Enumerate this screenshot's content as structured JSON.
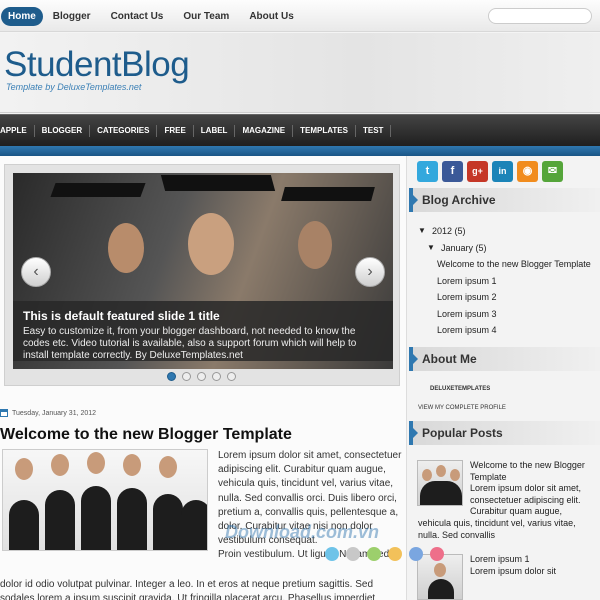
{
  "topnav": {
    "items": [
      {
        "label": "Home",
        "active": true
      },
      {
        "label": "Blogger"
      },
      {
        "label": "Contact Us"
      },
      {
        "label": "Our Team"
      },
      {
        "label": "About Us"
      }
    ],
    "search_placeholder": ""
  },
  "header": {
    "title": "StudentBlog",
    "tagline": "Template by DeluxeTemplates.net"
  },
  "categories": [
    "APPLE",
    "BLOGGER",
    "CATEGORIES",
    "FREE",
    "LABEL",
    "MAGAZINE",
    "TEMPLATES",
    "TEST"
  ],
  "slider": {
    "title": "This is default featured slide 1 title",
    "text": "Easy to customize it, from your blogger dashboard, not needed to know the codes etc. Video tutorial is available, also a support forum which will help to install template correctly. By DeluxeTemplates.net",
    "prev": "‹",
    "next": "›",
    "slide_count": 5,
    "active_slide": 1
  },
  "post": {
    "date": "Tuesday, January 31, 2012",
    "title": "Welcome to the new Blogger Template",
    "text_right": "Lorem ipsum dolor sit amet, consectetuer adipiscing elit. Curabitur quam augue, vehicula quis, tincidunt vel, varius vitae, nulla. Sed convallis orci. Duis libero orci, pretium a, convallis quis, pellentesque a, dolor. Curabitur vitae nisi non dolor vestibulum consequat.",
    "text_right2": "Proin vestibulum. Ut ligula. Nullam sed",
    "text_full": "dolor id odio volutpat pulvinar. Integer a leo. In et eros at neque pretium sagittis. Sed sodales lorem a ipsum suscipit gravida. Ut fringilla placerat arcu. Phasellus imperdiet"
  },
  "social": [
    {
      "name": "twitter",
      "glyph": "t",
      "color": "#33a8dd"
    },
    {
      "name": "facebook",
      "glyph": "f",
      "color": "#3b5998"
    },
    {
      "name": "google-plus",
      "glyph": "g+",
      "color": "#c53727"
    },
    {
      "name": "linkedin",
      "glyph": "in",
      "color": "#1b84b8"
    },
    {
      "name": "rss",
      "glyph": "◉",
      "color": "#f18c1e"
    },
    {
      "name": "email",
      "glyph": "✉",
      "color": "#55a53a"
    }
  ],
  "sidebar": {
    "archive": {
      "heading": "Blog Archive",
      "year": "2012",
      "year_count": "(5)",
      "month": "January",
      "month_count": "(5)",
      "posts": [
        "Welcome to the new Blogger Template",
        "Lorem ipsum 1",
        "Lorem ipsum 2",
        "Lorem ipsum 3",
        "Lorem ipsum 4"
      ]
    },
    "about": {
      "heading": "About Me",
      "name": "DELUXETEMPLATES",
      "profile_link": "VIEW MY COMPLETE PROFILE"
    },
    "popular": {
      "heading": "Popular Posts",
      "post1_title": "Welcome to the new Blogger Template",
      "post1_snippet": "Lorem ipsum dolor sit amet, consectetuer adipiscing elit. Curabitur quam augue,",
      "post1_snippet2": "vehicula quis, tincidunt vel, varius vitae, nulla. Sed convallis",
      "post2_title": "Lorem ipsum 1",
      "post2_snippet": "Lorem ipsum dolor sit"
    }
  },
  "watermark": "Download.com.vn"
}
